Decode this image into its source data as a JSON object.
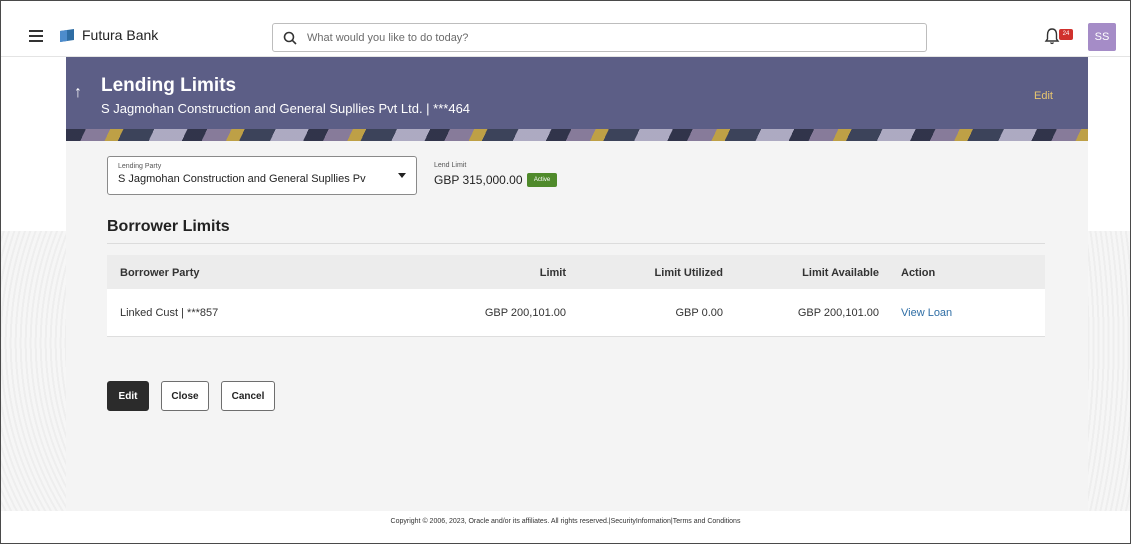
{
  "header": {
    "brand": "Futura Bank",
    "search_placeholder": "What would you like to do today?",
    "notification_count": "24",
    "avatar_initials": "SS",
    "icons": [
      "hamburger-icon",
      "bank-logo-icon",
      "search-icon",
      "bell-icon"
    ]
  },
  "banner": {
    "title": "Lending Limits",
    "subtitle": "S Jagmohan Construction and General Supllies Pvt Ltd. | ***464",
    "edit_label": "Edit",
    "back_icon": "up-arrow-icon"
  },
  "form": {
    "lending_party_label": "Lending Party",
    "lending_party_value": "S Jagmohan Construction and General Supllies Pv",
    "lend_limit_label": "Lend Limit",
    "lend_limit_value": "GBP 315,000.00",
    "status_badge": "Active"
  },
  "borrower_limits": {
    "title": "Borrower Limits",
    "columns": [
      "Borrower Party",
      "Limit",
      "Limit Utilized",
      "Limit Available",
      "Action"
    ],
    "rows": [
      {
        "party": "Linked Cust | ***857",
        "limit": "GBP 200,101.00",
        "utilized": "GBP 0.00",
        "available": "GBP 200,101.00",
        "action": "View Loan"
      }
    ]
  },
  "buttons": {
    "edit": "Edit",
    "close": "Close",
    "cancel": "Cancel"
  },
  "footer": {
    "text": "Copyright © 2006, 2023, Oracle and/or its affiliates. All rights reserved.|SecurityInformation|Terms and Conditions"
  },
  "colors": {
    "banner": "#5c5e86",
    "edit_link": "#e8c66f",
    "active_badge": "#4f8a2b",
    "link": "#2f6ea5",
    "primary_button": "#2b2b2b",
    "avatar": "#a58cc7",
    "notification_badge": "#d0312d"
  }
}
